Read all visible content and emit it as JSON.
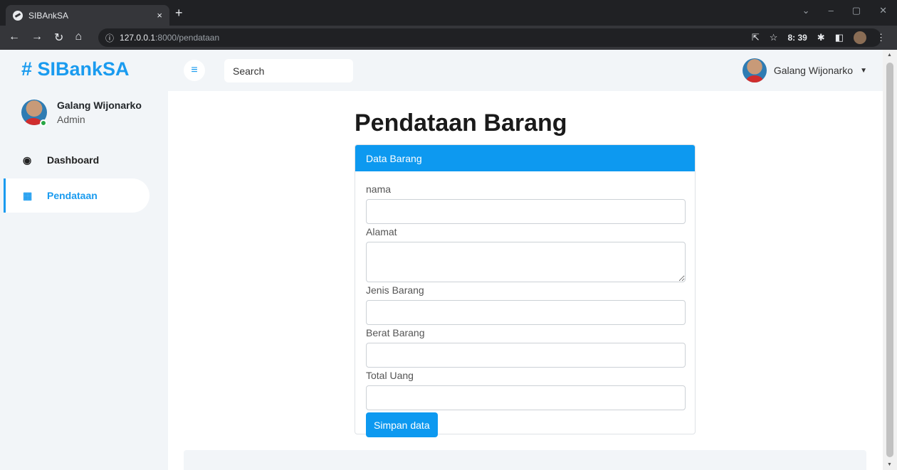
{
  "browser": {
    "tab_title": "SIBAnkSA",
    "tab_close": "×",
    "new_tab": "+",
    "url_host": "127.0.0.1",
    "url_path": ":8000/pendataan",
    "ext_time": "8: 39",
    "info_icon": "ⓘ"
  },
  "header": {
    "brand": "# SIBankSA",
    "menu_icon": "≡",
    "search_placeholder": "Search",
    "user_name": "Galang Wijonarko",
    "caret": "⌄"
  },
  "sidebar": {
    "profile_name": "Galang Wijonarko",
    "profile_role": "Admin",
    "items": [
      {
        "label": "Dashboard",
        "icon": "🚗"
      },
      {
        "label": "Pendataan",
        "icon": "▦"
      }
    ]
  },
  "main": {
    "title": "Pendataan Barang",
    "card_header": "Data Barang",
    "fields": [
      {
        "label": "nama",
        "value": ""
      },
      {
        "label": "Alamat",
        "value": ""
      },
      {
        "label": "Jenis Barang",
        "value": ""
      },
      {
        "label": "Berat Barang",
        "value": ""
      },
      {
        "label": "Total Uang",
        "value": ""
      }
    ],
    "submit_label": "Simpan data"
  },
  "colors": {
    "brand": "#1a9bef",
    "primary": "#0d99f0"
  }
}
